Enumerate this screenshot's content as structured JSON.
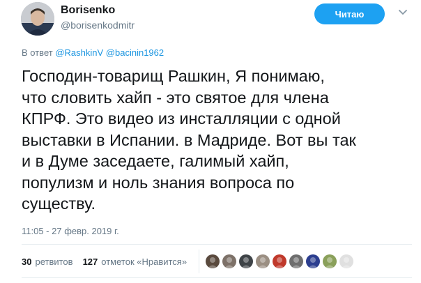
{
  "author": {
    "display_name": "Borisenko",
    "handle": "@borisenkodmitr",
    "avatar": "user-avatar"
  },
  "follow_button": {
    "label": "Читаю"
  },
  "menu_icon": "chevron-down-icon",
  "reply": {
    "prefix": "В ответ",
    "mentions": [
      "@RashkinV",
      "@bacinin1962"
    ]
  },
  "tweet": {
    "text": "Господин-товарищ Рашкин, Я понимаю,\nчто словить хайп - это святое для члена\nКПРФ. Это видео из инсталляции с одной\nвыставки в Испании. в Мадриде. Вот вы так\nи в Думе заседаете, галимый хайп,\nпопулизм и ноль знания вопроса по\nсуществу.",
    "timestamp": "11:05 - 27 февр. 2019 г."
  },
  "stats": {
    "retweets_count": "30",
    "retweets_label": "ретвитов",
    "likes_count": "127",
    "likes_label": "отметок «Нравится»"
  },
  "likers": [
    {
      "name": "liker-avatar-1",
      "color": "#5a4a3e"
    },
    {
      "name": "liker-avatar-2",
      "color": "#7d7168"
    },
    {
      "name": "liker-avatar-3",
      "color": "#3e4347"
    },
    {
      "name": "liker-avatar-4",
      "color": "#9b8f83"
    },
    {
      "name": "liker-avatar-5",
      "color": "#c0392b"
    },
    {
      "name": "liker-avatar-6",
      "color": "#6e6e6e"
    },
    {
      "name": "liker-avatar-7",
      "color": "#2c3e8f"
    },
    {
      "name": "liker-avatar-8",
      "color": "#8aa05a"
    },
    {
      "name": "liker-avatar-9",
      "color": "#e0e0e0"
    }
  ],
  "colors": {
    "accent": "#1da1f2",
    "link": "#1b95e0",
    "muted": "#657786",
    "text": "#14171a",
    "divider": "#e6ecf0"
  }
}
